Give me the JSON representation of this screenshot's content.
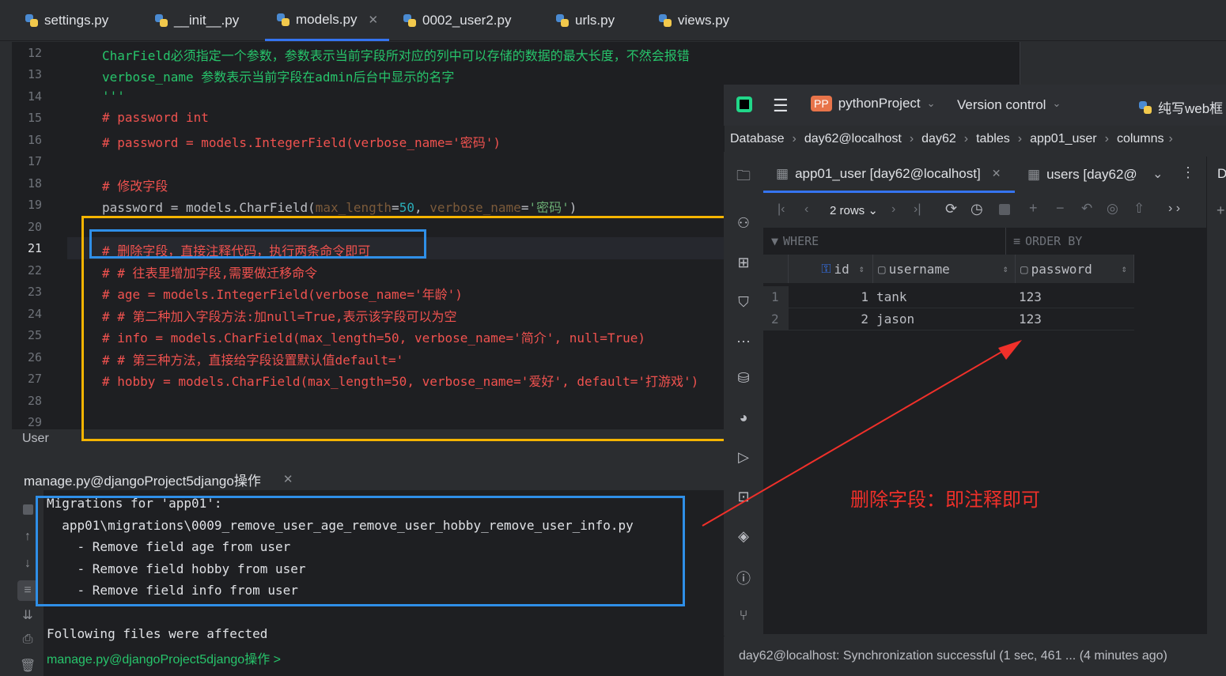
{
  "tabs": [
    {
      "label": "settings.py"
    },
    {
      "label": "__init__.py"
    },
    {
      "label": "models.py",
      "active": true
    },
    {
      "label": "0002_user2.py"
    },
    {
      "label": "urls.py"
    },
    {
      "label": "views.py"
    }
  ],
  "editor": {
    "line_numbers": [
      "12",
      "13",
      "14",
      "15",
      "16",
      "17",
      "18",
      "19",
      "20",
      "21",
      "22",
      "23",
      "24",
      "25",
      "26",
      "27",
      "28",
      "29"
    ],
    "lines": {
      "l12": "CharField必须指定一个参数，参数表示当前字段所对应的列中可以存储的数据的最大长度，不然会报错",
      "l13": "verbose_name 参数表示当前字段在admin后台中显示的名字",
      "l14": "'''",
      "l15": "# password int",
      "l16": "# password = models.IntegerField(verbose_name='密码')",
      "l18": "# 修改字段",
      "l19a": "password = models.CharField(",
      "l19b": "max_length",
      "l19c": "=",
      "l19d": "50",
      "l19e": ", ",
      "l19f": "verbose_name",
      "l19g": "=",
      "l19h": "'密码'",
      "l19i": ")",
      "l21": "# 删除字段，直接注释代码，执行两条命令即可",
      "l22": "# # 往表里增加字段,需要做迁移命令",
      "l23": "# age = models.IntegerField(verbose_name='年龄')",
      "l24": "# # 第二种加入字段方法:加null=True,表示该字段可以为空",
      "l25": "# info = models.CharField(max_length=50, verbose_name='简介', null=True)",
      "l26": "# # 第三种方法，直接给字段设置默认值default='",
      "l27": "# hobby = models.CharField(max_length=50, verbose_name='爱好', default='打游戏')"
    },
    "breadcrumb": "User"
  },
  "terminal": {
    "title": "manage.py@djangoProject5django操作",
    "lines": [
      "Migrations for 'app01':",
      "  app01\\migrations\\0009_remove_user_age_remove_user_hobby_remove_user_info.py",
      "    - Remove field age from user",
      "    - Remove field hobby from user",
      "    - Remove field info from user",
      "",
      "Following files were affected"
    ],
    "prompt": "manage.py@djangoProject5django操作 >"
  },
  "db": {
    "project_badge": "PP",
    "project": "pythonProject",
    "version_control": "Version control",
    "right_title": "纯写web框",
    "breadcrumbs": [
      "Database",
      "day62@localhost",
      "day62",
      "tables",
      "app01_user",
      "columns"
    ],
    "tab1": "app01_user [day62@localhost]",
    "tab2": "users [day62@",
    "rows_label": "2 rows",
    "where": "WHERE",
    "order_by": "ORDER BY",
    "columns": [
      "id",
      "username",
      "password"
    ],
    "rows": [
      {
        "n": "1",
        "id": "1",
        "username": "tank",
        "password": "123"
      },
      {
        "n": "2",
        "id": "2",
        "username": "jason",
        "password": "123"
      }
    ],
    "status": "day62@localhost: Synchronization successful (1 sec, 461 ... (4 minutes ago)",
    "side_letter": "D"
  },
  "annotation": {
    "text": "删除字段：即注释即可",
    "color": "#f0302a"
  },
  "colors": {
    "orange_box": "#f5b400",
    "blue_box": "#2f8fe8",
    "accent": "#3574f0"
  }
}
